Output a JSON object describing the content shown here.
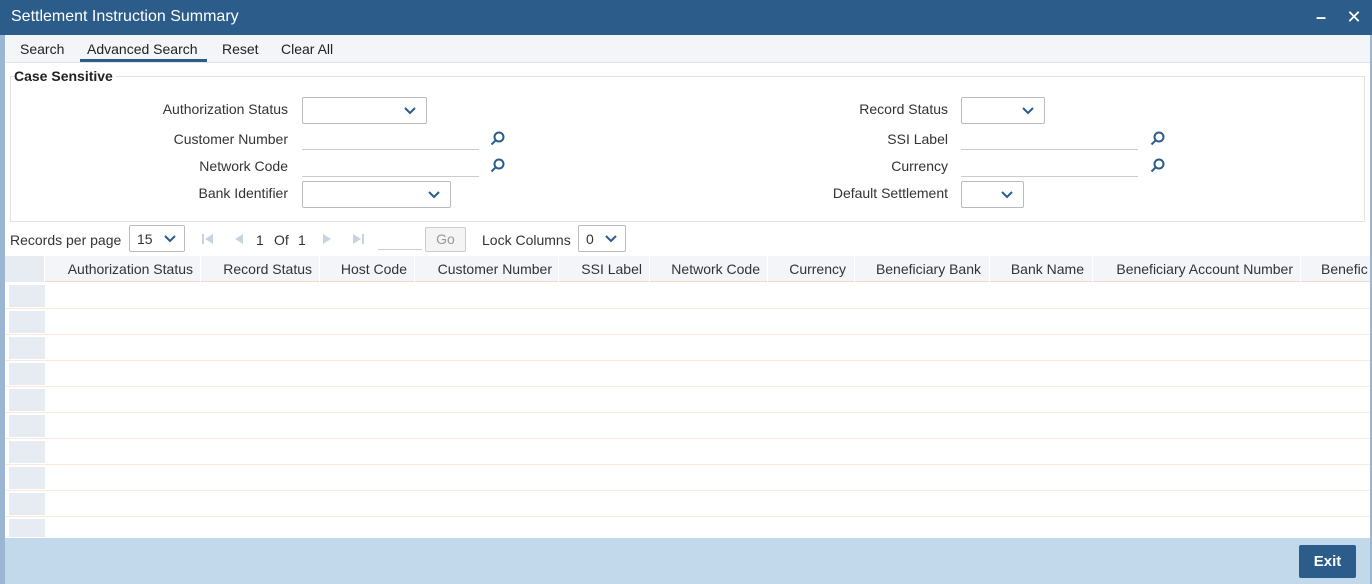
{
  "window": {
    "title": "Settlement Instruction Summary",
    "minimize": "–",
    "close": "✕"
  },
  "toolbar": {
    "search": "Search",
    "advanced_search": "Advanced Search",
    "reset": "Reset",
    "clear_all": "Clear All"
  },
  "criteria": {
    "legend": "Case Sensitive",
    "authorization_status": {
      "label": "Authorization Status",
      "value": ""
    },
    "record_status": {
      "label": "Record Status",
      "value": ""
    },
    "customer_number": {
      "label": "Customer Number",
      "value": ""
    },
    "ssi_label": {
      "label": "SSI Label",
      "value": ""
    },
    "network_code": {
      "label": "Network Code",
      "value": ""
    },
    "currency": {
      "label": "Currency",
      "value": ""
    },
    "bank_identifier": {
      "label": "Bank Identifier",
      "value": ""
    },
    "default_settlement": {
      "label": "Default Settlement",
      "value": ""
    }
  },
  "pager": {
    "records_per_page_label": "Records per page",
    "records_per_page": "15",
    "current_page": "1",
    "of_label": "Of",
    "total_pages": "1",
    "go_label": "Go",
    "lock_columns_label": "Lock Columns",
    "lock_columns": "0"
  },
  "grid": {
    "columns": [
      "Authorization Status",
      "Record Status",
      "Host Code",
      "Customer Number",
      "SSI Label",
      "Network Code",
      "Currency",
      "Beneficiary Bank",
      "Bank Name",
      "Beneficiary Account Number",
      "Benefic"
    ],
    "row_count": 10
  },
  "footer": {
    "exit_label": "Exit"
  },
  "colors": {
    "title_bar": "#2b5c8a",
    "footer": "#c1d9ea",
    "accent": "#2b5c8a"
  },
  "icons": [
    "chevron-down-icon",
    "search-lens-icon",
    "first-page-icon",
    "prev-page-icon",
    "next-page-icon",
    "last-page-icon"
  ]
}
